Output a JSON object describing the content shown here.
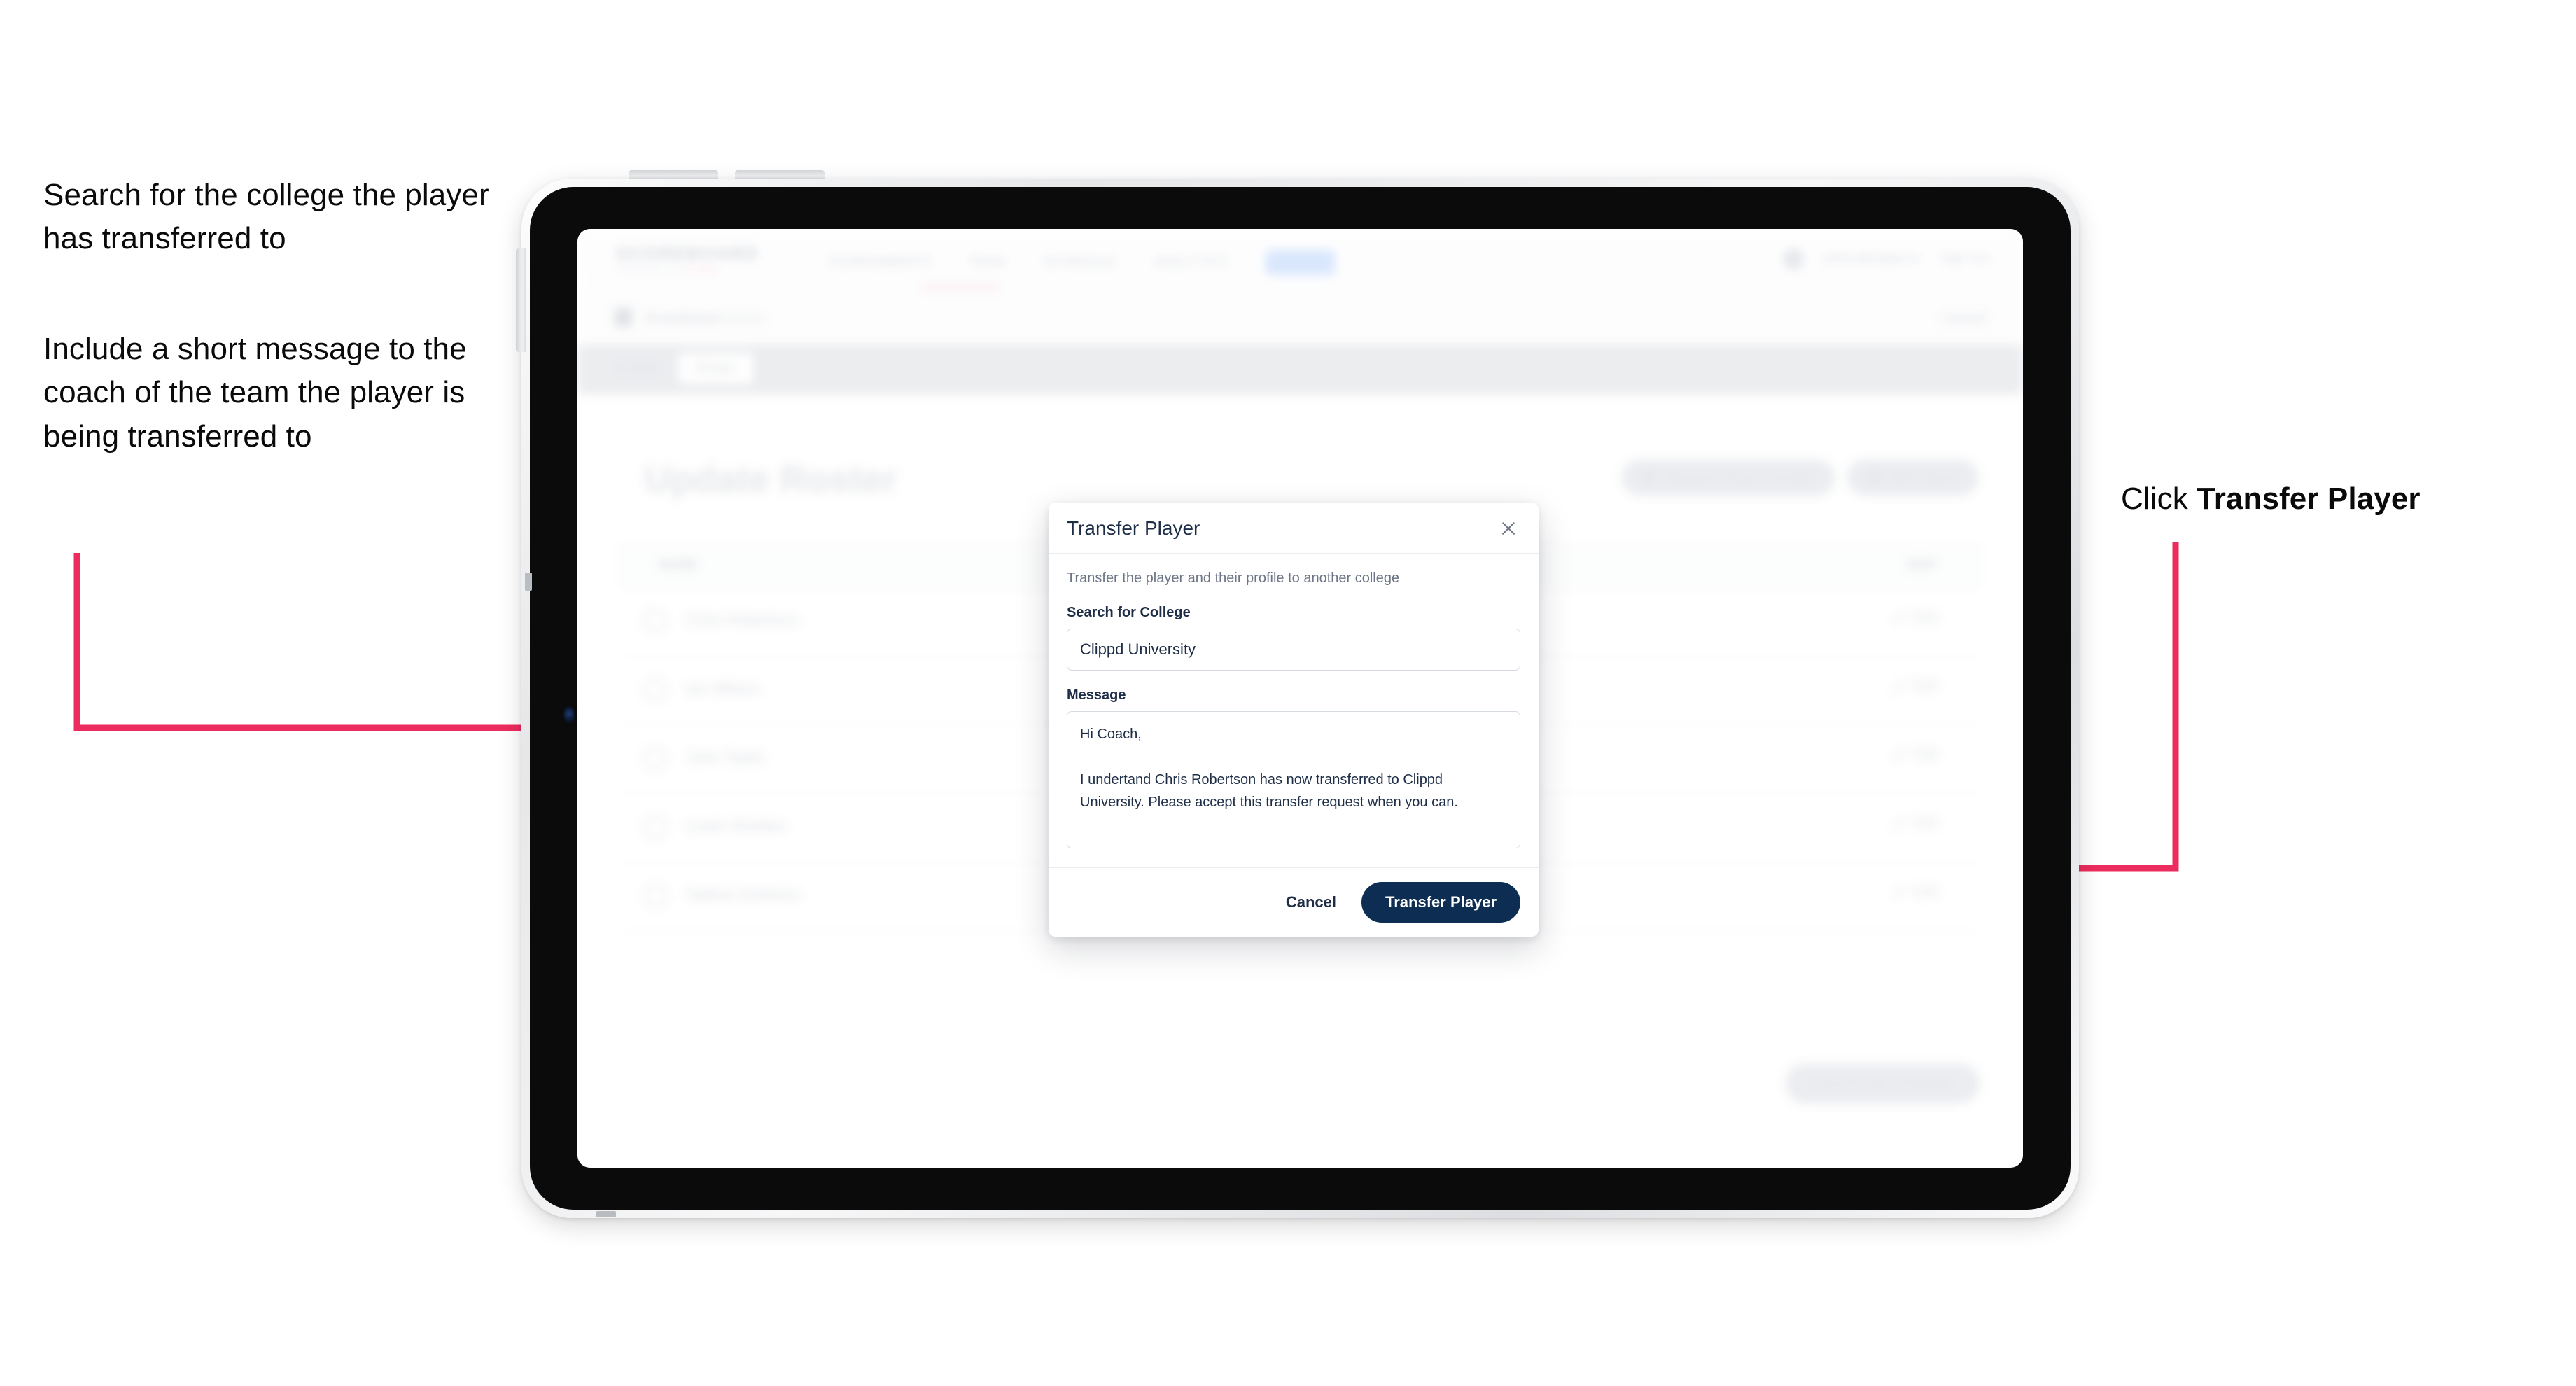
{
  "annotations": {
    "left_top": "Search for the college the player has transferred to",
    "left_bottom": "Include a short message to the coach of the team the player is being transferred to",
    "right_prefix": "Click ",
    "right_bold": "Transfer Player"
  },
  "colors": {
    "arrow": "#EC2C5E",
    "primary_button": "#0D2D52",
    "modal_title": "#1E2E47",
    "nav_pill": "#A9C8FB"
  },
  "device": {
    "type": "tablet",
    "buttons": [
      "volume-up",
      "volume-down",
      "power"
    ]
  },
  "app": {
    "logo": {
      "main": "SCOREBOARD",
      "sub": "POWERED BY",
      "sub_accent": "CLIPPD"
    },
    "nav": {
      "links": [
        {
          "label": "TOURNAMENTS",
          "active": false
        },
        {
          "label": "TEAM",
          "active": false
        },
        {
          "label": "SCHEDULE",
          "active": false
        },
        {
          "label": "ANALYTICS",
          "active": false
        }
      ],
      "pill_label": "ADMIN",
      "user_email": "admin@clippd.io",
      "sign_out": "Sign Out"
    },
    "breadcrumb": {
      "text": "Scoreboard",
      "text_dim": " Admin",
      "right": "Cancel"
    },
    "tabs": [
      {
        "label": "Details",
        "active": false
      },
      {
        "label": "Roster",
        "active": true
      }
    ],
    "page_title": "Update Roster",
    "top_actions": [
      {
        "label": "Request Player Transfer",
        "icon": "transfer-icon"
      },
      {
        "label": "Add Player",
        "icon": "plus-icon"
      }
    ],
    "table": {
      "columns": {
        "name": "NAME",
        "action": "EDIT"
      },
      "rows": [
        {
          "name": "Chris Robertson",
          "action": "Edit"
        },
        {
          "name": "Ian Wilson",
          "action": "Edit"
        },
        {
          "name": "John Taylor",
          "action": "Edit"
        },
        {
          "name": "Lewis Sheldon",
          "action": "Edit"
        },
        {
          "name": "Nathan Andrews",
          "action": "Edit"
        }
      ]
    },
    "bottom_action": "Save Roster Changes"
  },
  "modal": {
    "title": "Transfer Player",
    "close_icon": "close-icon",
    "subtitle": "Transfer the player and their profile to another college",
    "college": {
      "label": "Search for College",
      "value": "Clippd University",
      "placeholder": "Search for College"
    },
    "message": {
      "label": "Message",
      "value": "Hi Coach,\n\nI undertand Chris Robertson has now transferred to Clippd University. Please accept this transfer request when you can.",
      "placeholder": "Write a message"
    },
    "cancel_label": "Cancel",
    "submit_label": "Transfer Player"
  }
}
